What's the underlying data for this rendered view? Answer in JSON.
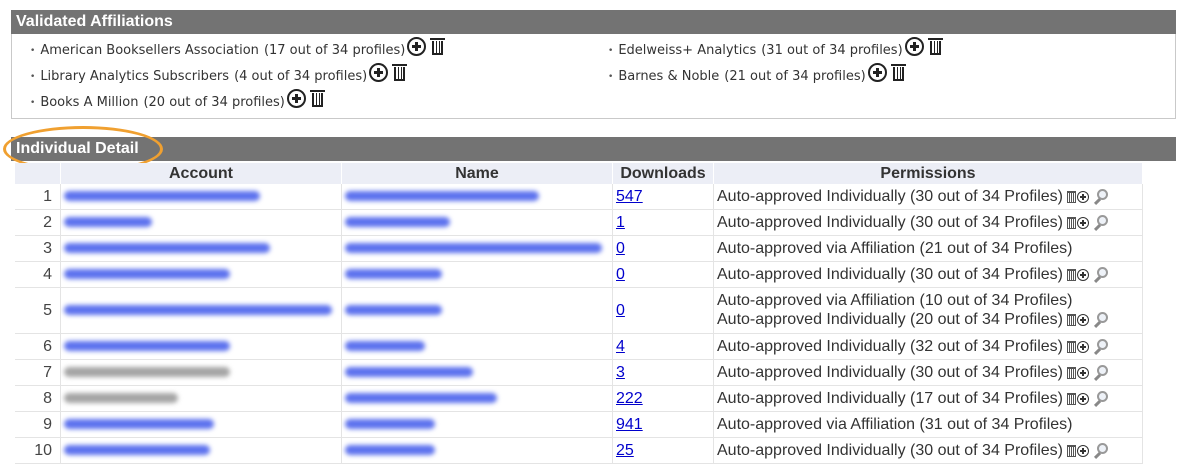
{
  "validated": {
    "title": "Validated Affiliations",
    "items": [
      {
        "name": "American Booksellers Association",
        "count": "(17 out of 34 profiles)"
      },
      {
        "name": "Edelweiss+ Analytics",
        "count": "(31 out of 34 profiles)"
      },
      {
        "name": "Library Analytics Subscribers",
        "count": "(4 out of 34 profiles)"
      },
      {
        "name": "Barnes & Noble",
        "count": "(21 out of 34 profiles)"
      },
      {
        "name": "Books A Million",
        "count": "(20 out of 34 profiles)"
      }
    ]
  },
  "detail": {
    "title": "Individual Detail",
    "columns": [
      "Account",
      "Name",
      "Downloads",
      "Permissions"
    ],
    "rows": [
      {
        "n": "1",
        "downloads": "547",
        "perm": [
          "Auto-approved Individually (30 out of 34 Profiles)"
        ],
        "icons": true
      },
      {
        "n": "2",
        "downloads": "1",
        "perm": [
          "Auto-approved Individually (30 out of 34 Profiles)"
        ],
        "icons": true
      },
      {
        "n": "3",
        "downloads": "0",
        "perm": [
          "Auto-approved via Affiliation (21 out of 34 Profiles)"
        ],
        "icons": false
      },
      {
        "n": "4",
        "downloads": "0",
        "perm": [
          "Auto-approved Individually (30 out of 34 Profiles)"
        ],
        "icons": true
      },
      {
        "n": "5",
        "downloads": "0",
        "perm": [
          "Auto-approved via Affiliation (10 out of 34 Profiles)",
          "Auto-approved Individually (20 out of 34 Profiles)"
        ],
        "icons": true
      },
      {
        "n": "6",
        "downloads": "4",
        "perm": [
          "Auto-approved Individually (32 out of 34 Profiles)"
        ],
        "icons": true
      },
      {
        "n": "7",
        "downloads": "3",
        "perm": [
          "Auto-approved Individually (30 out of 34 Profiles)"
        ],
        "icons": true
      },
      {
        "n": "8",
        "downloads": "222",
        "perm": [
          "Auto-approved Individually (17 out of 34 Profiles)"
        ],
        "icons": true
      },
      {
        "n": "9",
        "downloads": "941",
        "perm": [
          "Auto-approved via Affiliation (31 out of 34 Profiles)"
        ],
        "icons": false
      },
      {
        "n": "10",
        "downloads": "25",
        "perm": [
          "Auto-approved Individually (30 out of 34 Profiles)"
        ],
        "icons": true
      }
    ]
  },
  "colors": {
    "header_bg": "#737373",
    "highlight_oval": "#f0a030",
    "link": "#0000cc",
    "blurred_link": "#5d72ee"
  },
  "icons": [
    "plus-circle-icon",
    "trash-icon",
    "magnifier-icon"
  ]
}
